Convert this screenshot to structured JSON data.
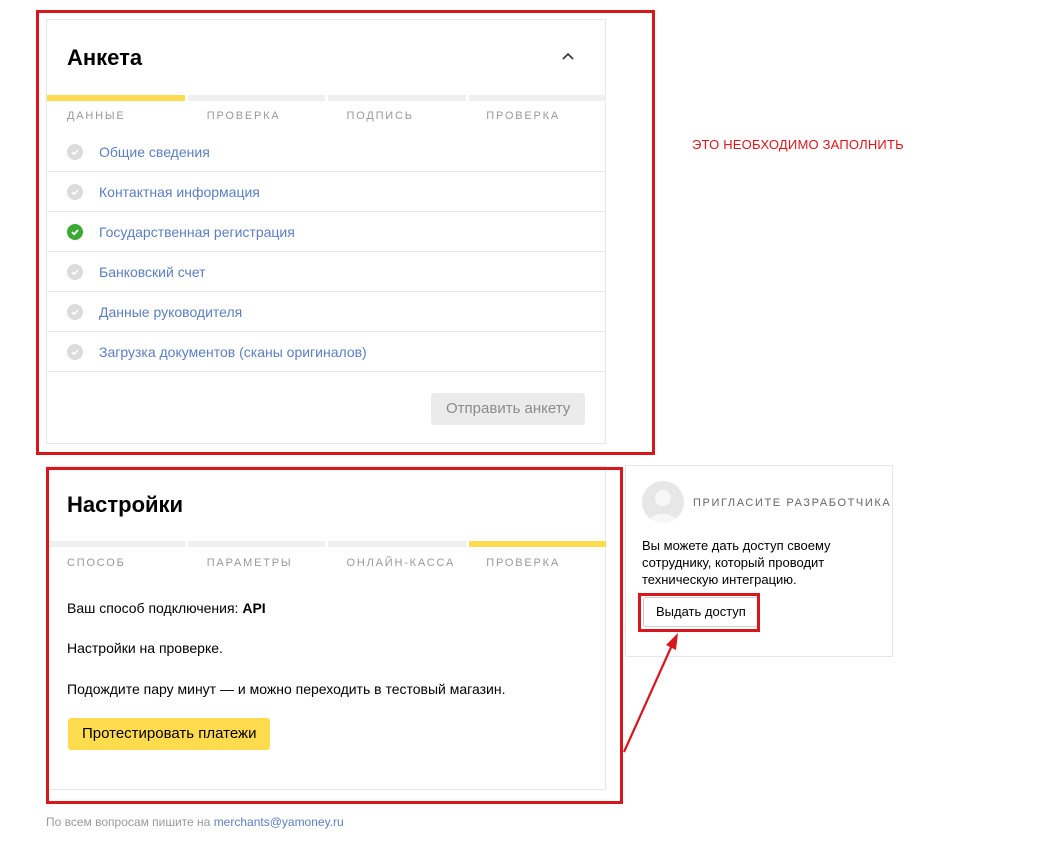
{
  "anketa": {
    "title": "Анкета",
    "steps": [
      "ДАННЫЕ",
      "ПРОВЕРКА",
      "ПОДПИСЬ",
      "ПРОВЕРКА"
    ],
    "active_step": 0,
    "items": [
      {
        "label": "Общие сведения",
        "done": false
      },
      {
        "label": "Контактная информация",
        "done": false
      },
      {
        "label": "Государственная регистрация",
        "done": true
      },
      {
        "label": "Банковский счет",
        "done": false
      },
      {
        "label": "Данные руководителя",
        "done": false
      },
      {
        "label": "Загрузка документов (сканы оригиналов)",
        "done": false
      }
    ],
    "submit_label": "Отправить анкету"
  },
  "annotation": {
    "note": "ЭТО НЕОБХОДИМО ЗАПОЛНИТЬ",
    "color": "#d9161b"
  },
  "settings": {
    "title": "Настройки",
    "steps": [
      "СПОСОБ",
      "ПАРАМЕТРЫ",
      "ОНЛАЙН-КАССА",
      "ПРОВЕРКА"
    ],
    "active_step": 3,
    "method_prefix": "Ваш способ подключения: ",
    "method_value": "API",
    "status": "Настройки на проверке.",
    "wait_text": "Подождите пару минут — и можно переходить в тестовый магазин.",
    "test_button": "Протестировать платежи"
  },
  "developer": {
    "title": "ПРИГЛАСИТЕ РАЗРАБОТЧИКА",
    "description": "Вы можете дать доступ своему сотруднику, который проводит техническую интеграцию.",
    "button": "Выдать доступ"
  },
  "footer": {
    "text": "По всем вопросам пишите на ",
    "email": "merchants@yamoney.ru"
  },
  "colors": {
    "accent_yellow": "#ffdb4d",
    "link_blue": "#5b7fbf",
    "success_green": "#3aaa35",
    "annotation_red": "#d9161b"
  }
}
